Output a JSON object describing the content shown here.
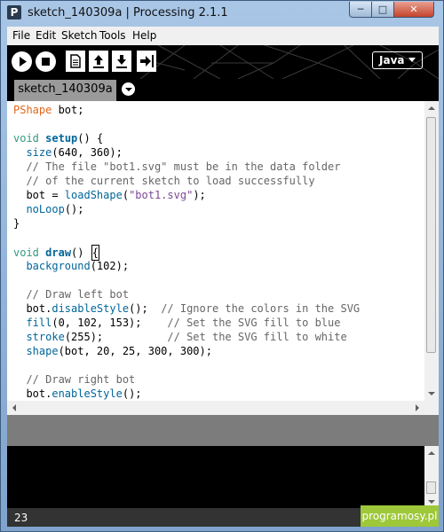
{
  "window": {
    "title": "sketch_140309a | Processing 2.1.1",
    "app_icon_letter": "P",
    "minimize_glyph": "─",
    "maximize_glyph": "□",
    "close_glyph": "✕"
  },
  "menu": {
    "items": [
      "File",
      "Edit",
      "Sketch",
      "Tools",
      "Help"
    ]
  },
  "toolbar": {
    "buttons": [
      "run-icon",
      "stop-icon",
      "new-icon",
      "open-icon",
      "save-icon",
      "export-icon"
    ],
    "mode": "Java",
    "colors": {
      "background": "#000000",
      "button": "#ffffff"
    }
  },
  "tabs": {
    "active": "sketch_140309a"
  },
  "editor": {
    "colors": {
      "keyword": "#33997e",
      "function": "#006699",
      "class": "#e2661a",
      "comment": "#666666",
      "string": "#7d4793"
    },
    "lines": [
      [
        {
          "t": "PShape",
          "c": "cls"
        },
        {
          "t": " bot;"
        }
      ],
      [],
      [
        {
          "t": "void",
          "c": "kw"
        },
        {
          "t": " "
        },
        {
          "t": "setup",
          "c": "fnb"
        },
        {
          "t": "() {"
        }
      ],
      [
        {
          "t": "  "
        },
        {
          "t": "size",
          "c": "fn"
        },
        {
          "t": "(640, 360);"
        }
      ],
      [
        {
          "t": "  // The file \"bot1.svg\" must be in the data folder",
          "c": "cm"
        }
      ],
      [
        {
          "t": "  // of the current sketch to load successfully",
          "c": "cm"
        }
      ],
      [
        {
          "t": "  bot = "
        },
        {
          "t": "loadShape",
          "c": "fn"
        },
        {
          "t": "("
        },
        {
          "t": "\"bot1.svg\"",
          "c": "str"
        },
        {
          "t": ");"
        }
      ],
      [
        {
          "t": "  "
        },
        {
          "t": "noLoop",
          "c": "fn"
        },
        {
          "t": "();"
        }
      ],
      [
        {
          "t": "}"
        }
      ],
      [],
      [
        {
          "t": "void",
          "c": "kw"
        },
        {
          "t": " "
        },
        {
          "t": "draw",
          "c": "fnb"
        },
        {
          "t": "() "
        },
        {
          "t": "{",
          "c": "caret"
        }
      ],
      [
        {
          "t": "  "
        },
        {
          "t": "background",
          "c": "fn"
        },
        {
          "t": "(102);"
        }
      ],
      [],
      [
        {
          "t": "  // Draw left bot",
          "c": "cm"
        }
      ],
      [
        {
          "t": "  bot."
        },
        {
          "t": "disableStyle",
          "c": "fn"
        },
        {
          "t": "();  "
        },
        {
          "t": "// Ignore the colors in the SVG",
          "c": "cm"
        }
      ],
      [
        {
          "t": "  "
        },
        {
          "t": "fill",
          "c": "fn"
        },
        {
          "t": "(0, 102, 153);    "
        },
        {
          "t": "// Set the SVG fill to blue",
          "c": "cm"
        }
      ],
      [
        {
          "t": "  "
        },
        {
          "t": "stroke",
          "c": "fn"
        },
        {
          "t": "(255);          "
        },
        {
          "t": "// Set the SVG fill to white",
          "c": "cm"
        }
      ],
      [
        {
          "t": "  "
        },
        {
          "t": "shape",
          "c": "fn"
        },
        {
          "t": "(bot, 20, 25, 300, 300);"
        }
      ],
      [],
      [
        {
          "t": "  // Draw right bot",
          "c": "cm"
        }
      ],
      [
        {
          "t": "  bot."
        },
        {
          "t": "enableStyle",
          "c": "fn"
        },
        {
          "t": "();"
        }
      ]
    ]
  },
  "status": {
    "line_number": "23"
  },
  "watermark": "programosy.pl"
}
